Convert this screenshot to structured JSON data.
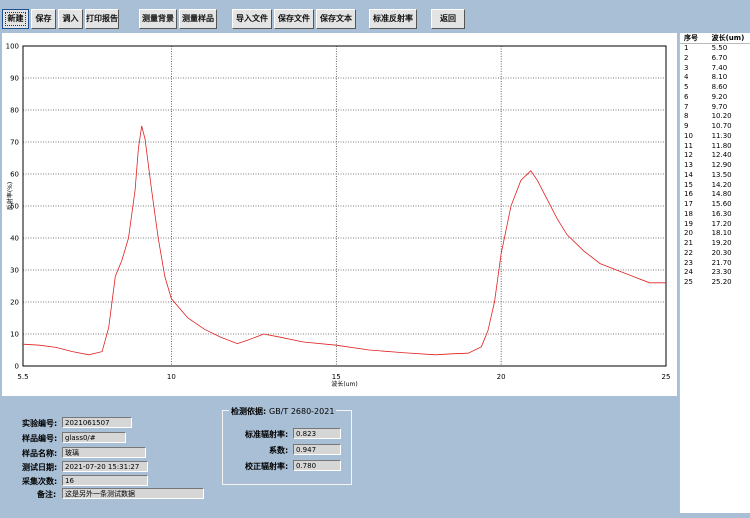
{
  "toolbar": {
    "buttons": [
      "新建",
      "保存",
      "调入",
      "打印报告",
      "测量背景",
      "测量样品",
      "导入文件",
      "保存文件",
      "保存文本",
      "标准反射率",
      "返回"
    ]
  },
  "chart_data": {
    "type": "line",
    "title": "",
    "xlabel": "波长(um)",
    "ylabel": "反射率(%)",
    "xlim": [
      5.5,
      25
    ],
    "ylim": [
      0,
      100
    ],
    "x_ticks": [
      "5.5",
      "10",
      "15",
      "20",
      "25"
    ],
    "y_ticks": [
      "0",
      "10",
      "20",
      "30",
      "40",
      "50",
      "60",
      "70",
      "80",
      "90",
      "100"
    ],
    "grid": true,
    "series": [
      {
        "color": "#e02020",
        "points": [
          [
            5.5,
            6.8
          ],
          [
            6.0,
            6.5
          ],
          [
            6.5,
            5.8
          ],
          [
            7.0,
            4.5
          ],
          [
            7.5,
            3.5
          ],
          [
            7.9,
            4.5
          ],
          [
            8.1,
            12
          ],
          [
            8.3,
            28
          ],
          [
            8.5,
            33
          ],
          [
            8.7,
            40
          ],
          [
            8.9,
            55
          ],
          [
            9.0,
            68
          ],
          [
            9.1,
            75
          ],
          [
            9.2,
            71
          ],
          [
            9.4,
            55
          ],
          [
            9.6,
            40
          ],
          [
            9.8,
            28
          ],
          [
            10.0,
            21
          ],
          [
            10.5,
            15
          ],
          [
            11.0,
            11.5
          ],
          [
            11.5,
            9
          ],
          [
            12.0,
            7
          ],
          [
            12.3,
            8
          ],
          [
            12.8,
            10
          ],
          [
            13.3,
            9
          ],
          [
            14.0,
            7.5
          ],
          [
            15.0,
            6.5
          ],
          [
            16.0,
            5
          ],
          [
            17.0,
            4.2
          ],
          [
            18.0,
            3.5
          ],
          [
            18.5,
            3.8
          ],
          [
            19.0,
            4
          ],
          [
            19.4,
            6
          ],
          [
            19.6,
            11
          ],
          [
            19.8,
            20
          ],
          [
            20.0,
            35
          ],
          [
            20.3,
            50
          ],
          [
            20.6,
            58
          ],
          [
            20.9,
            61
          ],
          [
            21.1,
            58
          ],
          [
            21.4,
            52
          ],
          [
            21.7,
            46
          ],
          [
            22.0,
            41
          ],
          [
            22.5,
            36
          ],
          [
            23.0,
            32
          ],
          [
            23.5,
            30
          ],
          [
            24.0,
            28
          ],
          [
            24.5,
            26
          ],
          [
            25.0,
            26
          ]
        ]
      }
    ]
  },
  "wavelength_table": {
    "headers": [
      "序号",
      "波长(um)"
    ],
    "rows": [
      [
        "1",
        "5.50"
      ],
      [
        "2",
        "6.70"
      ],
      [
        "3",
        "7.40"
      ],
      [
        "4",
        "8.10"
      ],
      [
        "5",
        "8.60"
      ],
      [
        "6",
        "9.20"
      ],
      [
        "7",
        "9.70"
      ],
      [
        "8",
        "10.20"
      ],
      [
        "9",
        "10.70"
      ],
      [
        "10",
        "11.30"
      ],
      [
        "11",
        "11.80"
      ],
      [
        "12",
        "12.40"
      ],
      [
        "13",
        "12.90"
      ],
      [
        "14",
        "13.50"
      ],
      [
        "15",
        "14.20"
      ],
      [
        "16",
        "14.80"
      ],
      [
        "17",
        "15.60"
      ],
      [
        "18",
        "16.30"
      ],
      [
        "19",
        "17.20"
      ],
      [
        "20",
        "18.10"
      ],
      [
        "21",
        "19.20"
      ],
      [
        "22",
        "20.30"
      ],
      [
        "23",
        "21.70"
      ],
      [
        "24",
        "23.30"
      ],
      [
        "25",
        "25.20"
      ]
    ]
  },
  "info": {
    "experiment_no_label": "实验编号:",
    "experiment_no": "2021061507",
    "sample_no_label": "样品编号:",
    "sample_no": "glass0/#",
    "sample_name_label": "样品名称:",
    "sample_name": "玻璃",
    "test_date_label": "测试日期:",
    "test_date": "2021-07-20 15:31:27",
    "samples_label": "采集次数:",
    "samples": "16",
    "remark_label": "备注:",
    "remark": "这是另外一条测试数据",
    "standard_label": "检测依据:",
    "standard": "GB/T 2680-2021",
    "std_emissivity_label": "标准辐射率:",
    "std_emissivity": "0.823",
    "coefficient_label": "系数:",
    "coefficient": "0.947",
    "corrected_emissivity_label": "校正辐射率:",
    "corrected_emissivity": "0.780"
  }
}
